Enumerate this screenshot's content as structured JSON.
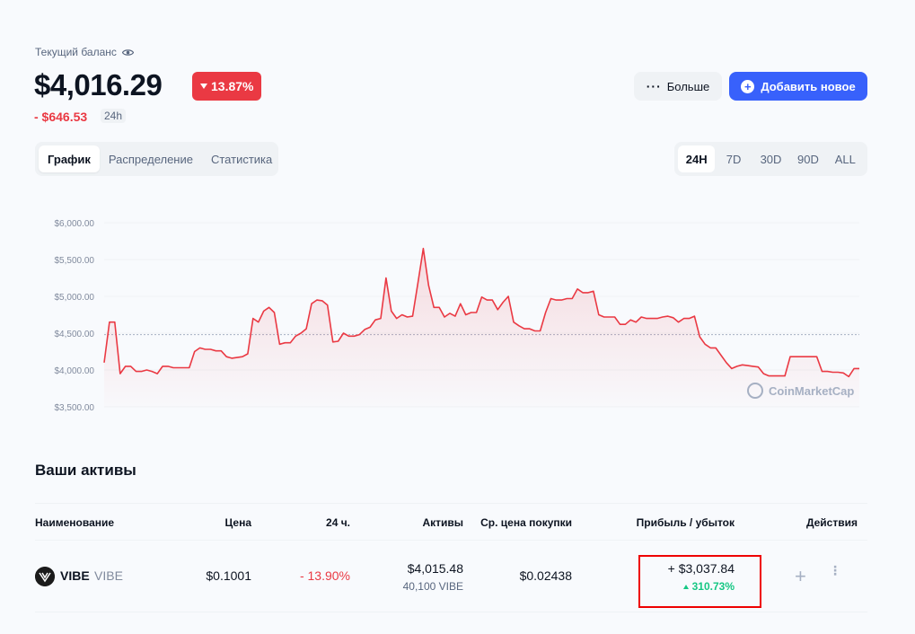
{
  "header": {
    "balance_label": "Текущий баланс",
    "balance": "$4,016.29",
    "change_pct": "13.87%",
    "change_abs": "- $646.53",
    "period": "24h",
    "more_label": "Больше",
    "add_label": "Добавить новое"
  },
  "tabs": [
    {
      "label": "График",
      "active": true
    },
    {
      "label": "Распределение",
      "active": false
    },
    {
      "label": "Статистика",
      "active": false
    }
  ],
  "ranges": [
    {
      "label": "24H",
      "active": true
    },
    {
      "label": "7D",
      "active": false
    },
    {
      "label": "30D",
      "active": false
    },
    {
      "label": "90D",
      "active": false
    },
    {
      "label": "ALL",
      "active": false
    }
  ],
  "colors": {
    "accent": "#3861fb",
    "negative": "#ea3943",
    "positive": "#16c784"
  },
  "chart_data": {
    "type": "area",
    "title": "",
    "xlabel": "",
    "ylabel": "",
    "ylim": [
      3500,
      6000
    ],
    "yticks": [
      "$6,000.00",
      "$5,500.00",
      "$5,000.00",
      "$4,500.00",
      "$4,000.00",
      "$3,500.00"
    ],
    "ytick_values": [
      6000,
      5500,
      5000,
      4500,
      4000,
      3500
    ],
    "reference_value": 4480,
    "watermark": "CoinMarketCap",
    "series": [
      {
        "values": [
          4100,
          4650,
          4650,
          3950,
          4050,
          4050,
          3980,
          3980,
          4000,
          3980,
          3950,
          4050,
          4050,
          4030,
          4030,
          4030,
          4030,
          4250,
          4300,
          4280,
          4280,
          4260,
          4260,
          4180,
          4160,
          4170,
          4180,
          4220,
          4700,
          4650,
          4800,
          4850,
          4780,
          4350,
          4370,
          4370,
          4460,
          4500,
          4560,
          4900,
          4950,
          4940,
          4880,
          4380,
          4390,
          4500,
          4460,
          4460,
          4480,
          4550,
          4580,
          4680,
          4700,
          5250,
          4800,
          4700,
          4750,
          4720,
          4730,
          5180,
          5650,
          5150,
          4850,
          4850,
          4720,
          4770,
          4730,
          4900,
          4750,
          4780,
          4780,
          4990,
          4950,
          4950,
          4820,
          4920,
          5000,
          4650,
          4600,
          4560,
          4560,
          4530,
          4530,
          4780,
          4970,
          4950,
          4950,
          4970,
          4970,
          5100,
          5050,
          5050,
          5070,
          4750,
          4720,
          4720,
          4720,
          4620,
          4620,
          4680,
          4650,
          4720,
          4700,
          4700,
          4700,
          4720,
          4730,
          4710,
          4650,
          4700,
          4700,
          4730,
          4450,
          4350,
          4300,
          4300,
          4200,
          4100,
          4020,
          4050,
          4070,
          4060,
          4050,
          4040,
          3950,
          3920,
          3920,
          3920,
          3920,
          4180,
          4180,
          4180,
          4180,
          4180,
          4180,
          3980,
          3980,
          3970,
          3970,
          3960,
          3910,
          4020,
          4020
        ]
      }
    ]
  },
  "assets": {
    "title": "Ваши активы",
    "columns": {
      "name": "Наименование",
      "price": "Цена",
      "change": "24 ч.",
      "holdings": "Активы",
      "avg_buy": "Ср. цена покупки",
      "pnl": "Прибыль / убыток",
      "actions": "Действия"
    },
    "rows": [
      {
        "name": "VIBE",
        "symbol": "VIBE",
        "price": "$0.1001",
        "change": "- 13.90%",
        "holdings_value": "$4,015.48",
        "holdings_amount": "40,100 VIBE",
        "avg_buy": "$0.02438",
        "pnl_value": "+ $3,037.84",
        "pnl_pct": "310.73%",
        "action_add": "+",
        "action_more": "⋮"
      }
    ]
  }
}
